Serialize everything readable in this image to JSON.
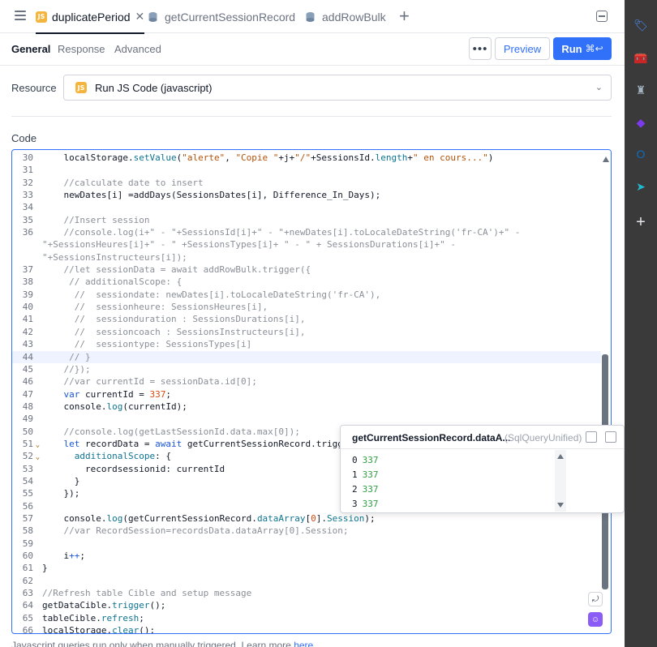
{
  "tabs": [
    {
      "label": "duplicatePeriod",
      "kind": "js",
      "active": true
    },
    {
      "label": "getCurrentSessionRecord",
      "kind": "db",
      "active": false
    },
    {
      "label": "addRowBulk",
      "kind": "db",
      "active": false
    }
  ],
  "tab_add_label": "+",
  "subtabs": [
    "General",
    "Response",
    "Advanced"
  ],
  "actions": {
    "more": "•••",
    "preview": "Preview",
    "run": "Run",
    "run_shortcut": "⌘↩"
  },
  "resource": {
    "label": "Resource",
    "value": "Run JS Code (javascript)",
    "badge": "JS"
  },
  "code_label": "Code",
  "code_lines": [
    {
      "n": "30",
      "html": "    localStorage.<span class=\"f\">setValue</span>(<span class=\"s\">\"alerte\"</span>, <span class=\"s\">\"Copie \"</span>+j+<span class=\"s\">\"/\"</span>+SessionsId.<span class=\"f\">length</span>+<span class=\"s\">\" en cours...\"</span>)"
    },
    {
      "n": "31",
      "html": ""
    },
    {
      "n": "32",
      "cmt": true,
      "html": "    //calculate date to insert"
    },
    {
      "n": "33",
      "html": "    newDates[i] =addDays(SessionsDates[i], Difference_In_Days);"
    },
    {
      "n": "34",
      "html": ""
    },
    {
      "n": "35",
      "cmt": true,
      "html": "    //Insert session"
    },
    {
      "n": "36",
      "cmt": true,
      "html": "    //console.log(i+\" - \"+SessionsId[i]+\" - \"+newDates[i].toLocaleDateString('fr-CA')+\" -",
      "wrap": [
        "\"+SessionsHeures[i]+\" - \" +SessionsTypes[i]+ \" - \" + SessionsDurations[i]+\" -",
        "\"+SessionsInstructeurs[i]);"
      ]
    },
    {
      "n": "37",
      "cmt": true,
      "html": "    //let sessionData = await addRowBulk.trigger({"
    },
    {
      "n": "38",
      "cmt": true,
      "html": "     // additionalScope: {"
    },
    {
      "n": "39",
      "cmt": true,
      "html": "      //  sessiondate: newDates[i].toLocaleDateString('fr-CA'),"
    },
    {
      "n": "40",
      "cmt": true,
      "html": "      //  sessionheure: SessionsHeures[i],"
    },
    {
      "n": "41",
      "cmt": true,
      "html": "      //  sessionduration : SessionsDurations[i],"
    },
    {
      "n": "42",
      "cmt": true,
      "html": "      //  sessioncoach : SessionsInstructeurs[i],"
    },
    {
      "n": "43",
      "cmt": true,
      "html": "      //  sessiontype: SessionsTypes[i]"
    },
    {
      "n": "44",
      "cmt": true,
      "hl": true,
      "html": "     // }"
    },
    {
      "n": "45",
      "cmt": true,
      "html": "    //});"
    },
    {
      "n": "46",
      "cmt": true,
      "html": "    //var currentId = sessionData.id[0];"
    },
    {
      "n": "47",
      "html": "    <span class=\"k\">var</span> currentId = <span class=\"n\">337</span>;"
    },
    {
      "n": "48",
      "html": "    console.<span class=\"f\">log</span>(currentId);"
    },
    {
      "n": "49",
      "html": ""
    },
    {
      "n": "50",
      "cmt": true,
      "html": "    //console.log(getLastSessionId.data.max[0]);"
    },
    {
      "n": "51",
      "fold": true,
      "html": "    <span class=\"k\">let</span> recordData = <span class=\"k\">await</span> getCurrentSessionRecord.trigger({"
    },
    {
      "n": "52",
      "fold": true,
      "html": "      <span class=\"f\">additionalScope</span>: {"
    },
    {
      "n": "53",
      "html": "        recordsessionid: currentId"
    },
    {
      "n": "54",
      "html": "      }"
    },
    {
      "n": "55",
      "html": "    });"
    },
    {
      "n": "56",
      "html": ""
    },
    {
      "n": "57",
      "html": "    console.<span class=\"f\">log</span>(getCurrentSessionRecord.<span class=\"f\">dataArray</span>[<span class=\"n\">0</span>].<span class=\"f\">Session</span>);"
    },
    {
      "n": "58",
      "cmt": true,
      "html": "    //var RecordSession=recordsData.dataArray[0].Session;"
    },
    {
      "n": "59",
      "html": ""
    },
    {
      "n": "60",
      "html": "    i<span class=\"k\">++</span>;"
    },
    {
      "n": "61",
      "html": "}"
    },
    {
      "n": "62",
      "html": ""
    },
    {
      "n": "63",
      "cmt": true,
      "html": "//Refresh table Cible and setup message"
    },
    {
      "n": "64",
      "html": "getDataCible.<span class=\"f\">trigger</span>();"
    },
    {
      "n": "65",
      "html": "tableCible.<span class=\"f\">refresh</span>;"
    },
    {
      "n": "66",
      "html": "localStorage.<span class=\"f\">clear</span>();"
    }
  ],
  "popup": {
    "title": "getCurrentSessionRecord.dataA...",
    "type": "(SqlQueryUnified)",
    "rows": [
      {
        "index": "0",
        "value": "337"
      },
      {
        "index": "1",
        "value": "337"
      },
      {
        "index": "2",
        "value": "337"
      },
      {
        "index": "3",
        "value": "337"
      }
    ]
  },
  "footer": {
    "text": "Javascript queries run only when manually triggered. Learn more ",
    "link": "here"
  },
  "rail_icons": [
    {
      "name": "tag-icon",
      "glyph": "🏷",
      "color": "#4c8df6"
    },
    {
      "name": "toolbox-icon",
      "glyph": "🧰",
      "color": "#e8590c"
    },
    {
      "name": "chess-icon",
      "glyph": "♜",
      "color": "#a5b4c3"
    },
    {
      "name": "copilot-icon",
      "glyph": "◆",
      "color": "#7c3aed"
    },
    {
      "name": "outlook-icon",
      "glyph": "O",
      "color": "#0f6cbd"
    },
    {
      "name": "send-icon",
      "glyph": "➤",
      "color": "#22b8cf"
    },
    {
      "name": "add-icon",
      "glyph": "+",
      "color": "#e5e7eb"
    }
  ]
}
